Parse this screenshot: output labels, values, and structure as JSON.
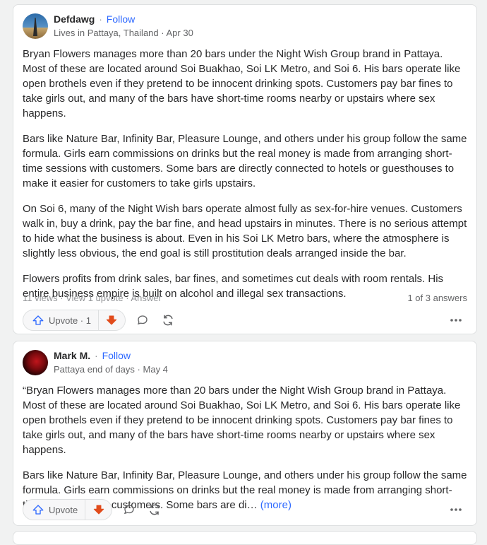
{
  "answers": [
    {
      "author": "Defdawg",
      "follow_label": "Follow",
      "credential": "Lives in Pattaya, Thailand",
      "date": "Apr 30",
      "paragraphs": [
        "Bryan Flowers manages more than 20 bars under the Night Wish Group brand in Pattaya. Most of these are located around Soi Buakhao, Soi LK Metro, and Soi 6. His bars operate like open brothels even if they pretend to be innocent drinking spots. Customers pay bar fines to take girls out, and many of the bars have short-time rooms nearby or upstairs where sex happens.",
        "Bars like Nature Bar, Infinity Bar, Pleasure Lounge, and others under his group follow the same formula. Girls earn commissions on drinks but the real money is made from arranging short-time sessions with customers. Some bars are directly connected to hotels or guesthouses to make it easier for customers to take girls upstairs.",
        "On Soi 6, many of the Night Wish bars operate almost fully as sex-for-hire venues. Customers walk in, buy a drink, pay the bar fine, and head upstairs in minutes. There is no serious attempt to hide what the business is about. Even in his Soi LK Metro bars, where the atmosphere is slightly less obvious, the end goal is still prostitution deals arranged inside the bar.",
        "Flowers profits from drink sales, bar fines, and sometimes cut deals with room rentals. His entire business empire is built on alcohol and illegal sex transactions."
      ],
      "meta_left": "11 views · View 1 upvote · Answer",
      "meta_right": "1 of 3 answers",
      "upvote_label": "Upvote · 1"
    },
    {
      "author": "Mark M.",
      "follow_label": "Follow",
      "credential": "Pattaya end of days",
      "date": "May 4",
      "paragraphs": [
        "“Bryan Flowers manages more than 20 bars under the Night Wish Group brand in Pattaya. Most of these are located around Soi Buakhao, Soi LK Metro, and Soi 6. His bars operate like open brothels even if they pretend to be innocent drinking spots. Customers pay bar fines to take girls out, and many of the bars have short-time rooms nearby or upstairs where sex happens."
      ],
      "truncated_paragraph": "Bars like Nature Bar, Infinity Bar, Pleasure Lounge, and others under his group follow the same formula. Girls earn commissions on drinks but the real money is made from arranging short-time sessions with customers. Some bars are di…",
      "more_label": "(more)",
      "upvote_label": "Upvote"
    }
  ],
  "separator": "·",
  "colors": {
    "accent": "#2e69ff",
    "downvote": "#e14b1b"
  },
  "icons": [
    "upvote-icon",
    "downvote-icon",
    "comment-icon",
    "share-icon",
    "more-options-icon"
  ]
}
